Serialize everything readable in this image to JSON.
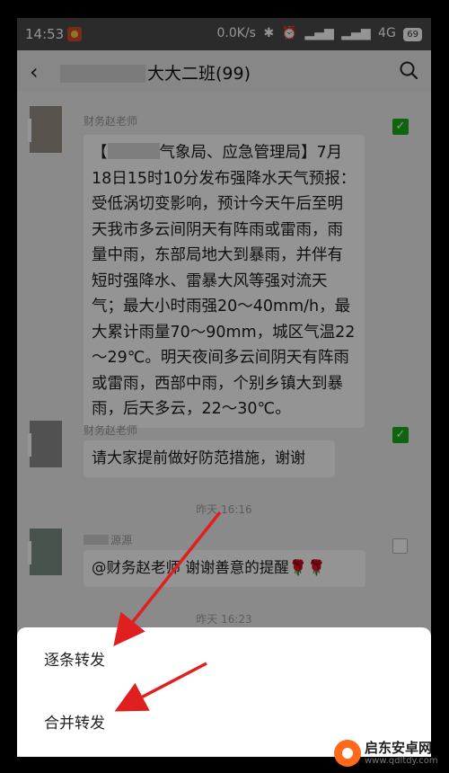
{
  "status_bar": {
    "time": "14:53",
    "network_speed": "0.0K/s",
    "signal_label": "4G",
    "battery": "69"
  },
  "header": {
    "back_icon": "chevron-left-icon",
    "title": "大大二班(99)",
    "search_icon": "search-icon"
  },
  "messages": [
    {
      "sender": "财务赵老师",
      "text_prefix": "【",
      "text": "气象局、应急管理局】7月18日15时10分发布强降水天气预报：受低涡切变影响，预计今天午后至明天我市多云间阴天有阵雨或雷雨，雨量中雨，东部局地大到暴雨，并伴有短时强降水、雷暴大风等强对流天气；最大小时雨强20～40mm/h，最大累计雨量70～90mm，城区气温22～29℃。明天夜间多云间阴天有阵雨或雷雨，西部中雨，个别乡镇大到暴雨，后天多云，22～30℃。",
      "checked": true
    },
    {
      "sender": "财务赵老师",
      "text": "请大家提前做好防范措施，谢谢",
      "checked": true
    },
    {
      "sender": "源源",
      "text": "@财务赵老师  谢谢善意的提醒🌹🌹",
      "checked": false
    }
  ],
  "timestamps": [
    "昨天 16:16",
    "昨天 16:23"
  ],
  "sheet": {
    "forward_one_by_one": "逐条转发",
    "forward_combined": "合并转发"
  },
  "watermark": {
    "name": "启东安卓网",
    "url": "www.qdltdy.com"
  },
  "colors": {
    "check_green": "#1aad19",
    "arrow_red": "#e02020",
    "status_bar": "#4a4a4a"
  }
}
